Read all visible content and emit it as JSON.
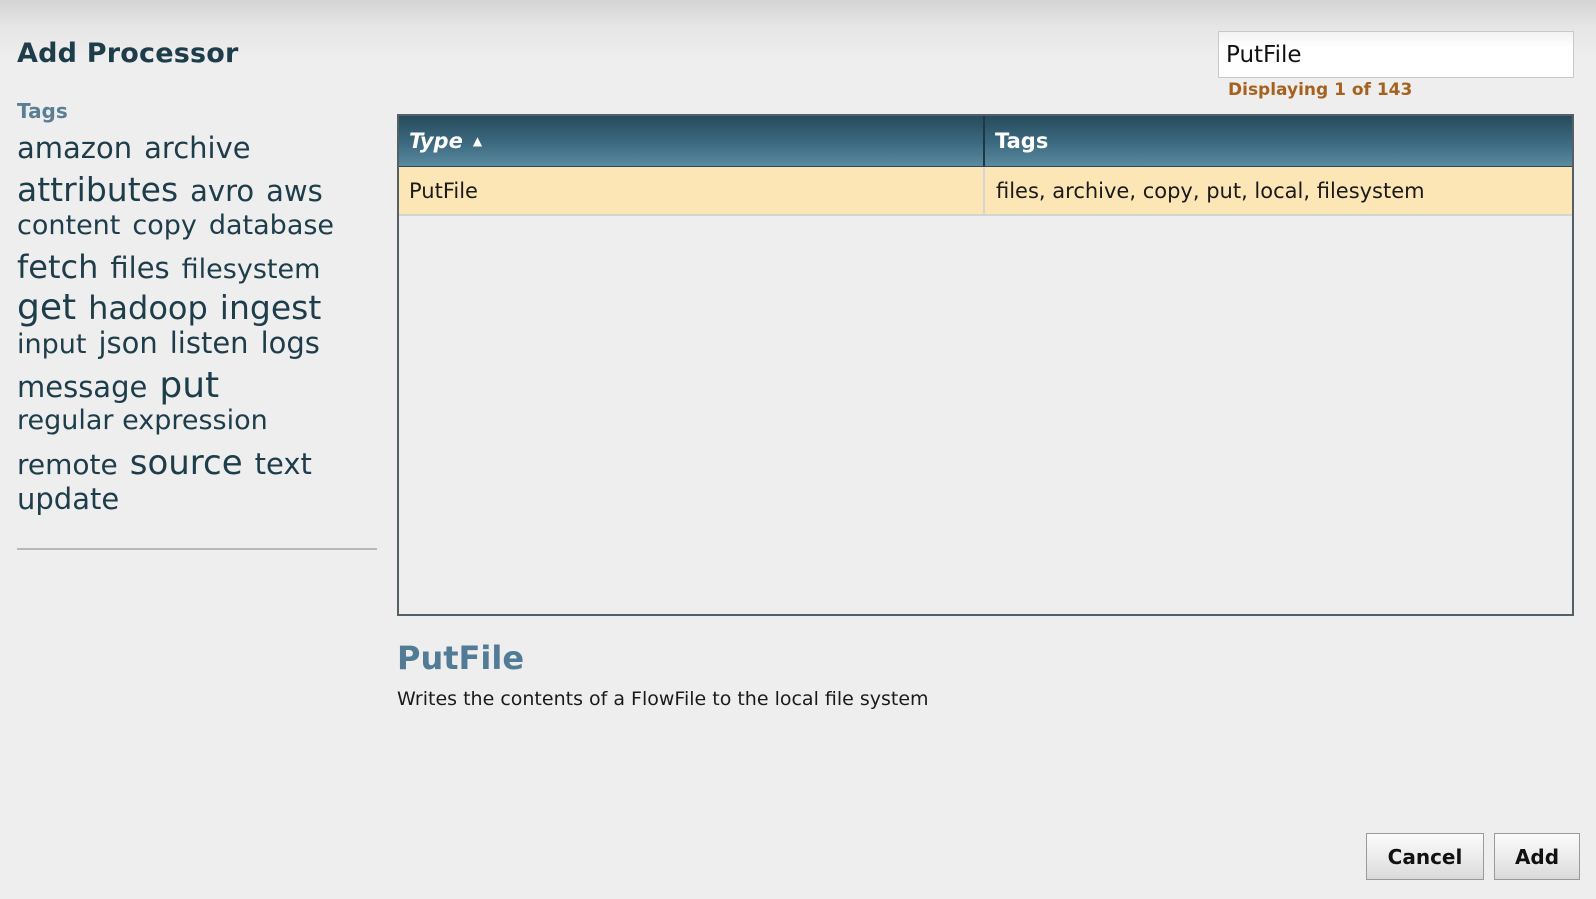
{
  "dialog": {
    "title": "Add Processor"
  },
  "tags_panel": {
    "heading": "Tags",
    "lines": [
      [
        {
          "label": "amazon",
          "size": 29
        },
        {
          "label": "archive",
          "size": 29
        }
      ],
      [
        {
          "label": "attributes",
          "size": 33
        },
        {
          "label": "avro",
          "size": 29
        },
        {
          "label": "aws",
          "size": 29
        }
      ],
      [
        {
          "label": "content",
          "size": 27
        },
        {
          "label": "copy",
          "size": 27
        },
        {
          "label": "database",
          "size": 27
        }
      ],
      [
        {
          "label": "fetch",
          "size": 32
        },
        {
          "label": "files",
          "size": 29
        },
        {
          "label": "filesystem",
          "size": 27
        }
      ],
      [
        {
          "label": "get",
          "size": 36
        },
        {
          "label": "hadoop",
          "size": 32
        },
        {
          "label": "ingest",
          "size": 33
        }
      ],
      [
        {
          "label": "input",
          "size": 27
        },
        {
          "label": "json",
          "size": 29
        },
        {
          "label": "listen",
          "size": 29
        },
        {
          "label": "logs",
          "size": 29
        }
      ],
      [
        {
          "label": "message",
          "size": 29
        },
        {
          "label": "put",
          "size": 36
        }
      ],
      [
        {
          "label": "regular expression",
          "size": 27
        }
      ],
      [
        {
          "label": "remote",
          "size": 28
        },
        {
          "label": "source",
          "size": 34
        },
        {
          "label": "text",
          "size": 29
        }
      ],
      [
        {
          "label": "update",
          "size": 29
        }
      ]
    ]
  },
  "search": {
    "value": "PutFile",
    "count_text": "Displaying 1 of 143"
  },
  "grid": {
    "columns": {
      "type": "Type",
      "tags": "Tags"
    },
    "rows": [
      {
        "type": "PutFile",
        "tags": "files, archive, copy, put, local, filesystem"
      }
    ]
  },
  "detail": {
    "title": "PutFile",
    "description": "Writes the contents of a FlowFile to the local file system"
  },
  "buttons": {
    "cancel": "Cancel",
    "add": "Add"
  }
}
